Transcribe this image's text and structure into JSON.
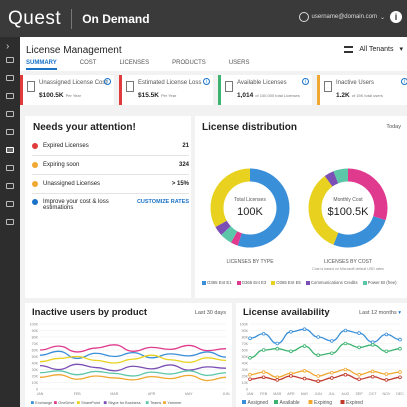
{
  "header": {
    "logo": "Quest",
    "product": "On Demand",
    "user": "username@domain.com"
  },
  "page": {
    "title": "License Management",
    "tenant_filter": "All Tenants"
  },
  "tabs": [
    {
      "label": "SUMMARY"
    },
    {
      "label": "COST"
    },
    {
      "label": "LICENSES"
    },
    {
      "label": "PRODUCTS"
    },
    {
      "label": "USERS"
    }
  ],
  "cards": [
    {
      "label": "Unassigned License Cost",
      "value": "$100.5K",
      "sub": "Per Year",
      "accent": "#e03a3a"
    },
    {
      "label": "Estimated License Loss",
      "value": "$15.5K",
      "sub": "Per Year",
      "accent": "#e03a3a"
    },
    {
      "label": "Available Licenses",
      "value": "1,014",
      "sub": "of 100,000 total Licenses",
      "accent": "#3cb371"
    },
    {
      "label": "Inactive Users",
      "value": "1.2K",
      "sub": "of 15K total users",
      "accent": "#f0a830"
    }
  ],
  "attention": {
    "title": "Needs your attention!",
    "rows": [
      {
        "label": "Expired Licenses",
        "value": "21",
        "color": "#e03a3a"
      },
      {
        "label": "Expiring soon",
        "value": "324",
        "color": "#f0a830"
      },
      {
        "label": "Unassigned Licenses",
        "value": "> 15%",
        "color": "#f0a830"
      },
      {
        "label": "Improve your cost & loss",
        "label2": "estimations",
        "value": "CUSTOMIZE RATES",
        "color": "#1a73c9"
      }
    ]
  },
  "distribution": {
    "title": "License distribution",
    "range": "Today",
    "donut1": {
      "center_label": "Total Licenses",
      "center_value": "100K",
      "caption": "LICENSES BY TYPE"
    },
    "donut2": {
      "center_label": "Monthly Cost",
      "center_value": "$100.5K",
      "caption": "LICENSES BY COST",
      "note": "Cost is based on Microsoft default USD rates"
    },
    "legend": [
      {
        "label": "O365 Ent E1",
        "color": "#3a8fd9"
      },
      {
        "label": "O365 Ent E3",
        "color": "#e03a8f"
      },
      {
        "label": "O365 Ent E5",
        "color": "#e8d21f"
      },
      {
        "label": "Communications Credits",
        "color": "#7b4fb5"
      },
      {
        "label": "Power BI (free)",
        "color": "#5cc7a8"
      }
    ]
  },
  "chart_data": [
    {
      "type": "donut",
      "title": "LICENSES BY TYPE",
      "slices": [
        {
          "name": "O365 Ent E1",
          "value": 55,
          "color": "#3a8fd9"
        },
        {
          "name": "O365 Ent E3",
          "value": 3,
          "color": "#e03a8f"
        },
        {
          "name": "O365 Ent E5",
          "value": 5,
          "color": "#5cc7a8"
        },
        {
          "name": "Communications Credits",
          "value": 4,
          "color": "#7b4fb5"
        },
        {
          "name": "Power BI (free)",
          "value": 33,
          "color": "#e8d21f"
        }
      ]
    },
    {
      "type": "donut",
      "title": "LICENSES BY COST",
      "slices": [
        {
          "name": "O365 Ent E3",
          "value": 30,
          "color": "#e03a8f"
        },
        {
          "name": "O365 Ent E1",
          "value": 26,
          "color": "#3a8fd9"
        },
        {
          "name": "Power BI (free)",
          "value": 34,
          "color": "#e8d21f"
        },
        {
          "name": "Communications Credits",
          "value": 4,
          "color": "#7b4fb5"
        },
        {
          "name": "O365 Ent E5",
          "value": 6,
          "color": "#5cc7a8"
        }
      ]
    },
    {
      "type": "line",
      "title": "Inactive users by product",
      "range": "Last 30 days",
      "categories": [
        "JAN",
        "FEB",
        "MAR",
        "APR",
        "MAY",
        "JUN"
      ],
      "ylim": [
        0,
        100
      ],
      "yticks": [
        "0",
        "10K",
        "20K",
        "30K",
        "40K",
        "50K",
        "60K",
        "70K",
        "80K",
        "90K",
        "100K"
      ],
      "series": [
        {
          "name": "Exchange",
          "color": "#3a8fd9",
          "values": [
            52,
            58,
            47,
            55,
            50,
            56,
            48,
            54,
            51,
            57,
            49
          ]
        },
        {
          "name": "OneDrive",
          "color": "#e03a8f",
          "values": [
            60,
            66,
            57,
            63,
            68,
            58,
            64,
            61,
            67,
            59,
            62
          ]
        },
        {
          "name": "SharePoint",
          "color": "#e8d21f",
          "values": [
            42,
            47,
            50,
            44,
            40,
            46,
            52,
            45,
            41,
            48,
            44
          ]
        },
        {
          "name": "Skype for Business",
          "color": "#7b4fb5",
          "values": [
            36,
            30,
            38,
            33,
            28,
            35,
            31,
            37,
            29,
            34,
            32
          ]
        },
        {
          "name": "Teams",
          "color": "#5cc7a8",
          "values": [
            25,
            28,
            22,
            27,
            24,
            20,
            26,
            23,
            28,
            21,
            25
          ]
        },
        {
          "name": "Yammer",
          "color": "#f0a830",
          "values": [
            18,
            22,
            15,
            20,
            17,
            14,
            19,
            16,
            21,
            13,
            18
          ]
        }
      ]
    },
    {
      "type": "line",
      "title": "License availability",
      "range": "Last 12 months",
      "categories": [
        "JAN",
        "FEB",
        "MAR",
        "APR",
        "MAY",
        "JUN",
        "JUL",
        "AUG",
        "SEP",
        "OCT",
        "NOV",
        "DEC"
      ],
      "ylim": [
        0,
        100
      ],
      "yticks": [
        "0",
        "10K",
        "20K",
        "30K",
        "40K",
        "50K",
        "60K",
        "70K",
        "80K",
        "90K",
        "100K"
      ],
      "series": [
        {
          "name": "Assigned",
          "color": "#3a8fd9",
          "values": [
            78,
            85,
            70,
            88,
            92,
            80,
            74,
            90,
            86,
            72,
            84,
            76
          ]
        },
        {
          "name": "Available",
          "color": "#3cb371",
          "values": [
            48,
            60,
            62,
            58,
            66,
            52,
            55,
            70,
            64,
            68,
            58,
            62
          ]
        },
        {
          "name": "Expiring",
          "color": "#f0a830",
          "values": [
            22,
            26,
            18,
            24,
            28,
            20,
            25,
            30,
            22,
            27,
            23,
            26
          ]
        },
        {
          "name": "Expired",
          "color": "#c0392b",
          "values": [
            15,
            18,
            14,
            20,
            16,
            12,
            17,
            22,
            15,
            19,
            14,
            18
          ]
        }
      ]
    }
  ]
}
